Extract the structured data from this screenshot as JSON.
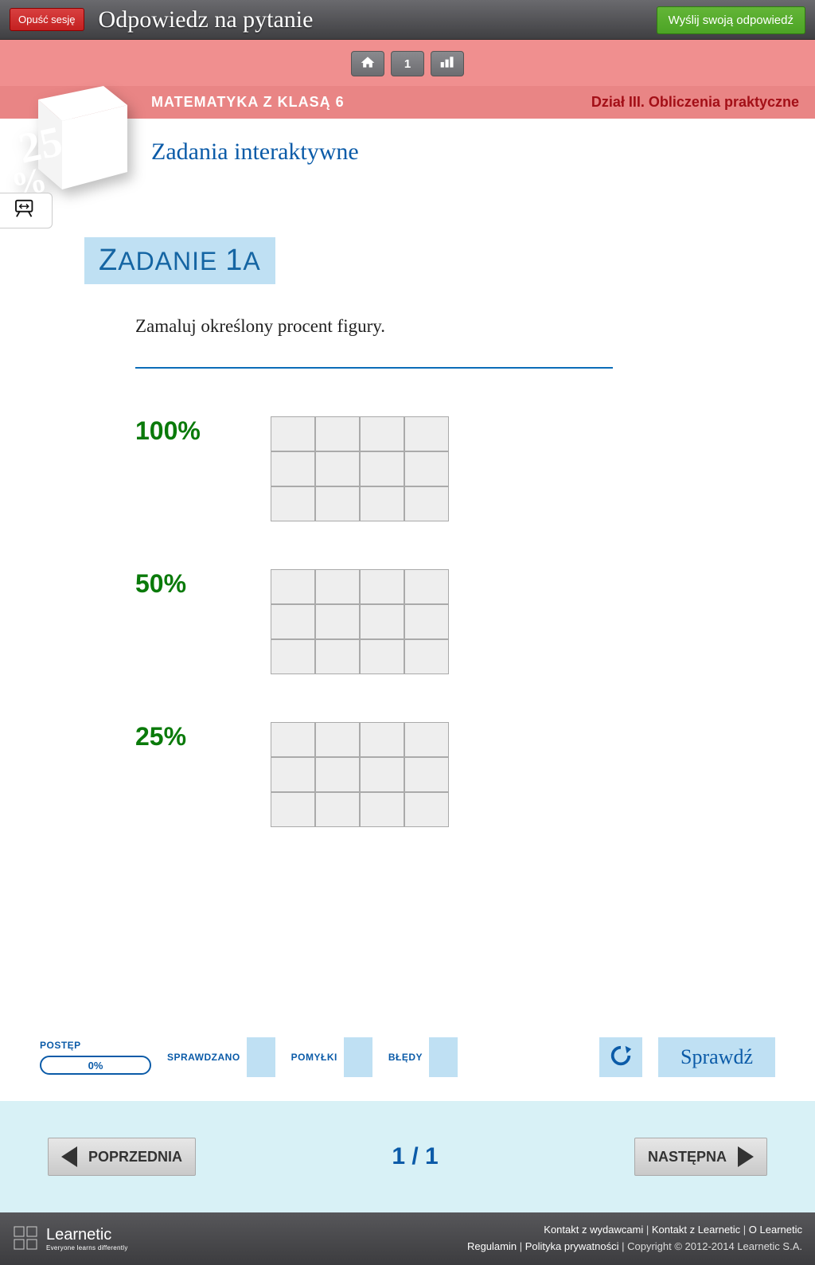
{
  "topbar": {
    "leave": "Opuść sesję",
    "title": "Odpowiedz na pytanie",
    "send": "Wyślij swoją odpowiedź"
  },
  "toolbar": {
    "page_num": "1"
  },
  "pink": {
    "course": "MATEMATYKA Z KLASĄ 6",
    "section": "Dział III. Obliczenia praktyczne"
  },
  "cube_percent": "25%",
  "lesson_title": "Zadania interaktywne",
  "task": {
    "label_prefix": "Z",
    "label_rest": "ADANIE ",
    "label_num_big": "1",
    "label_num_small": "A",
    "prompt": "Zamaluj określony procent figury."
  },
  "figures": [
    {
      "percent": "100%"
    },
    {
      "percent": "50%"
    },
    {
      "percent": "25%"
    }
  ],
  "grid": {
    "cols": 4,
    "rows": 3
  },
  "status": {
    "progress_label": "POSTĘP",
    "progress_value": "0%",
    "checked_label": "SPRAWDZANO",
    "mistakes_label": "POMYŁKI",
    "errors_label": "BŁĘDY",
    "check_label": "Sprawdź"
  },
  "nav": {
    "prev": "POPRZEDNIA",
    "next": "NASTĘPNA",
    "page": "1 / 1"
  },
  "footer": {
    "brand": "Learnetic",
    "tagline": "Everyone learns differently",
    "links": {
      "publishers": "Kontakt z wydawcami",
      "contact": "Kontakt z Learnetic",
      "about": "O Learnetic",
      "terms": "Regulamin",
      "privacy": "Polityka prywatności",
      "copyright": "Copyright © 2012-2014 Learnetic S.A."
    }
  }
}
